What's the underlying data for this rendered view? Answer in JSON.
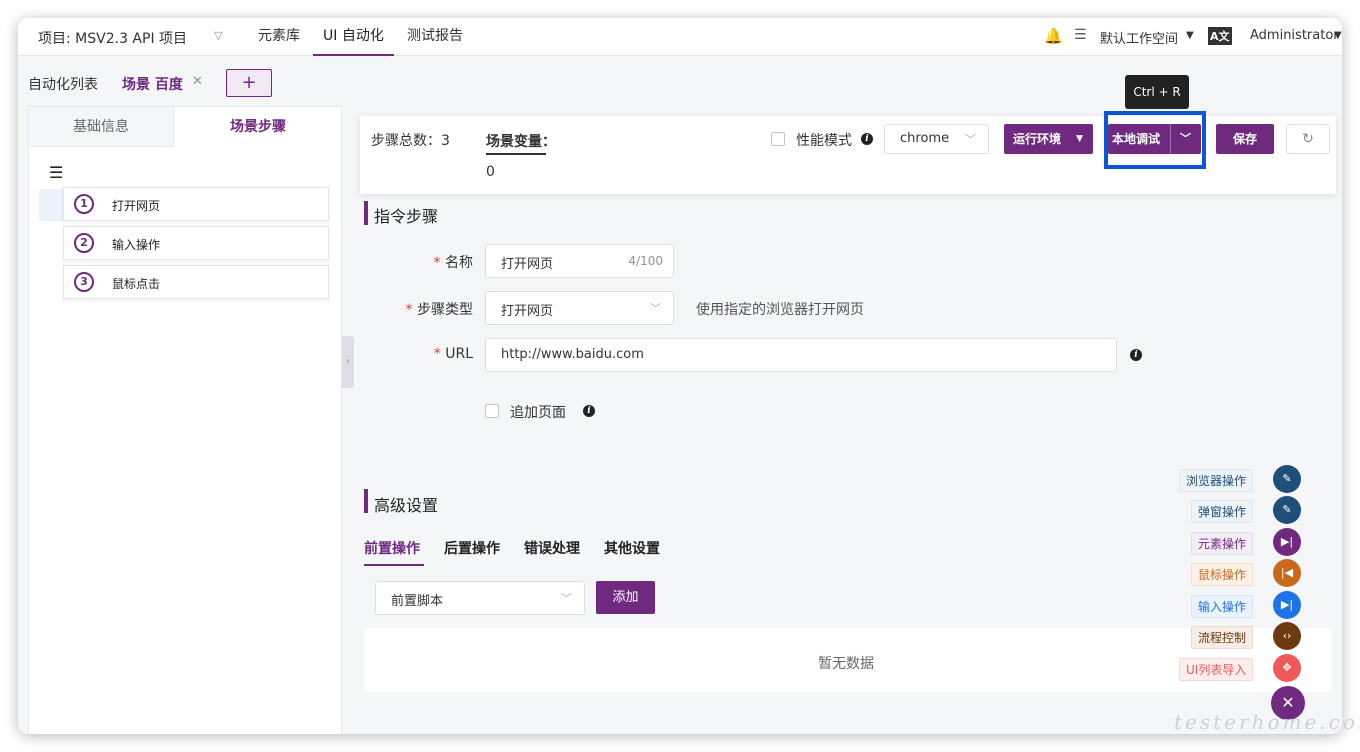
{
  "header": {
    "project": "项目: MSV2.3 API 项目",
    "nav": [
      "元素库",
      "UI 自动化",
      "测试报告"
    ],
    "workspace": "默认工作空间",
    "user": "Administrator"
  },
  "tabs": {
    "list_label": "自动化列表",
    "active_tab": "场景 百度",
    "add_label": "+"
  },
  "left_panel": {
    "tabs": [
      "基础信息",
      "场景步骤"
    ],
    "steps": [
      {
        "num": "1",
        "label": "打开网页"
      },
      {
        "num": "2",
        "label": "输入操作"
      },
      {
        "num": "3",
        "label": "鼠标点击"
      }
    ]
  },
  "toolbar": {
    "steps_total": "步骤总数：3",
    "scene_var_label": "场景变量：",
    "scene_var_value": "0",
    "perf_mode": "性能模式",
    "browser": "chrome",
    "run_env": "运行环境",
    "local_debug": "本地调试",
    "save": "保存",
    "tooltip": "Ctrl + R"
  },
  "form": {
    "section_title": "指令步骤",
    "name_label": "名称",
    "name_value": "打开网页",
    "name_count": "4/100",
    "type_label": "步骤类型",
    "type_value": "打开网页",
    "type_hint": "使用指定的浏览器打开网页",
    "url_label": "URL",
    "url_value": "http://www.baidu.com",
    "append_page": "追加页面",
    "required_mark": "*"
  },
  "advanced": {
    "section_title": "高级设置",
    "tabs": [
      "前置操作",
      "后置操作",
      "错误处理",
      "其他设置"
    ],
    "script_select": "前置脚本",
    "add_button": "添加",
    "empty": "暂无数据"
  },
  "fab_actions": [
    {
      "label": "浏览器操作",
      "color": "#1f4e79",
      "icon": "pen-icon"
    },
    {
      "label": "弹窗操作",
      "color": "#1f4e79",
      "icon": "pen-icon"
    },
    {
      "label": "元素操作",
      "color": "#6f2a80",
      "icon": "next-icon"
    },
    {
      "label": "鼠标操作",
      "color": "#c8691c",
      "icon": "prev-icon"
    },
    {
      "label": "输入操作",
      "color": "#1e73e8",
      "icon": "next-icon"
    },
    {
      "label": "流程控制",
      "color": "#6b3a10",
      "icon": "code-icon"
    },
    {
      "label": "UI列表导入",
      "color": "#f0595a",
      "icon": "move-icon"
    }
  ],
  "watermark": "testerhome.com",
  "colors": {
    "accent": "#6f2a80",
    "highlight_box": "#0b55d6"
  }
}
